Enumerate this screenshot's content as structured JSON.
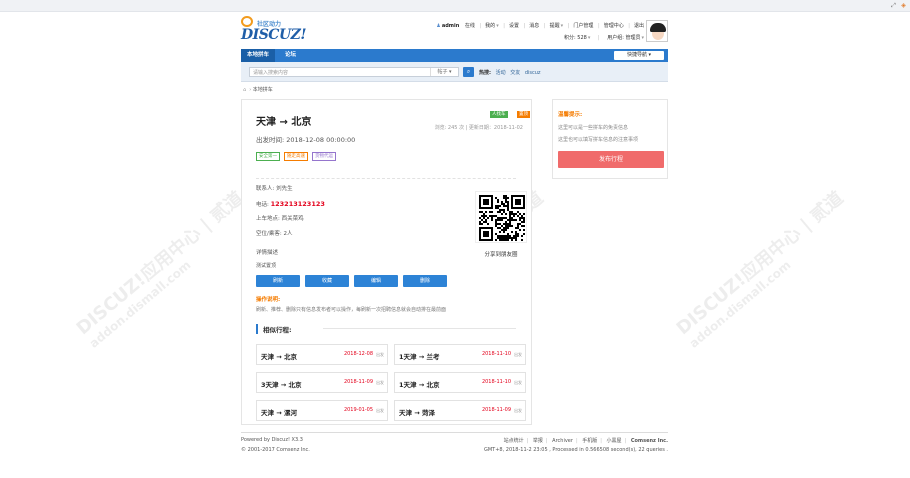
{
  "logo": {
    "slogan": "社区动力",
    "word": "DISCUZ!"
  },
  "user": {
    "name": "admin",
    "status": "在线",
    "links": [
      "我的",
      "设置",
      "消息",
      "提醒",
      "门户管理",
      "管理中心",
      "退出"
    ],
    "points": "积分: 528",
    "group": "用户组: 管理员"
  },
  "nav": {
    "tabs": [
      "本地拼车",
      "论坛"
    ],
    "quick": "快捷导航"
  },
  "search": {
    "placeholder": "请输入搜索内容",
    "scope": "帖子",
    "hot_label": "热搜:",
    "hot": [
      "活动",
      "交友",
      "discuz"
    ]
  },
  "breadcrumb": {
    "current": "本地拼车"
  },
  "post": {
    "title": "天津 → 北京",
    "depart": "出发时间: 2018-12-08 00:00:00",
    "tags": [
      {
        "text": "人找车",
        "color": "#4caf50"
      },
      {
        "text": "置顶",
        "color": "#f57c00"
      }
    ],
    "stats": "浏览: 245  次 | 更新日期：2018-11-02",
    "chips": [
      {
        "text": "安全第一",
        "color": "#4caf50"
      },
      {
        "text": "随走高速",
        "color": "#f57c00"
      },
      {
        "text": "货物代运",
        "color": "#9575cd"
      }
    ],
    "contact_label": "联系人: 刘先生",
    "phone_label": "电话: ",
    "phone": "123213123123",
    "pickup": "上车地点: 西关菜鸡",
    "seats": "空位/乘客: 2人",
    "detail_heading": "详情描述",
    "detail": "测试置顶",
    "qr_label": "分享到朋友圈",
    "actions": [
      "刷新",
      "收藏",
      "编辑",
      "删除"
    ],
    "op_title": "操作说明:",
    "op_text": "刷新、推荐、删除只有信息发布者可以操作，每刷新一次招聘信息就会自动排在最前面"
  },
  "similar": {
    "heading": "相似行程:",
    "items": [
      {
        "route": "天津 → 北京",
        "date": "2018-12-08",
        "status": "出发"
      },
      {
        "route": "1天津 → 兰考",
        "date": "2018-11-10",
        "status": "出发"
      },
      {
        "route": "3天津 → 北京",
        "date": "2018-11-09",
        "status": "出发"
      },
      {
        "route": "1天津 → 北京",
        "date": "2018-11-10",
        "status": "出发"
      },
      {
        "route": "天津 → 漯河",
        "date": "2019-01-05",
        "status": "出发"
      },
      {
        "route": "天津 → 菏泽",
        "date": "2018-11-09",
        "status": "出发"
      }
    ]
  },
  "sidebar": {
    "heading": "温馨提示:",
    "lines": [
      "这里可以是一些拼车的免责信息",
      "这里也可以填写拼车信息的注意事项"
    ],
    "publish": "发布行程"
  },
  "footer": {
    "powered": "Powered by Discuz! X3.3",
    "copyright": "© 2001-2017 Comsenz Inc.",
    "links": [
      "站点统计",
      "举报",
      "Archiver",
      "手机版",
      "小黑屋",
      "Comsenz Inc."
    ],
    "processed": "GMT+8, 2018-11-2 23:05 , Processed in 0.566508 second(s), 22 queries ."
  },
  "watermark": {
    "line1": "DISCUZ!应用中心 | 贰道",
    "line2": "addon.dismall.com"
  }
}
